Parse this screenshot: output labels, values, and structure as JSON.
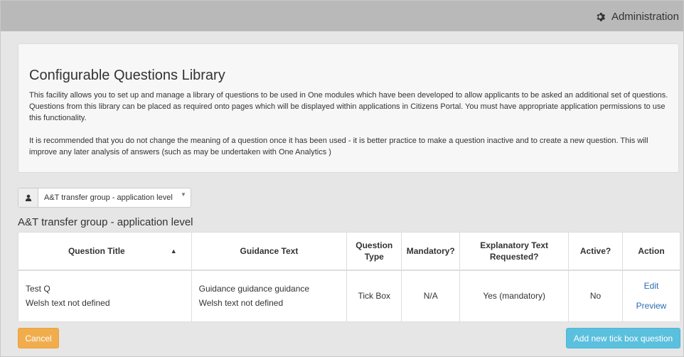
{
  "header": {
    "admin_label": "Administration",
    "admin_icon": "gear-icon"
  },
  "intro": {
    "title": "Configurable Questions Library",
    "paragraph1": "This facility allows you to set up and manage a library of questions to be used in One modules which have been developed to allow applicants to be asked an additional set of questions. Questions from this library can be placed as required onto pages which will be displayed within applications in Citizens Portal. You must have appropriate application permissions to use this functionality.",
    "paragraph2": "It is recommended that you do not change the meaning of a question once it has been used - it is better practice to make a question inactive and to create a new question. This will improve any later analysis of answers (such as may be undertaken with One Analytics )"
  },
  "group_select": {
    "icon": "user-icon",
    "selected": "A&T transfer group - application level"
  },
  "section_title": "A&T transfer group - application level",
  "table": {
    "columns": [
      "Question Title",
      "Guidance Text",
      "Question Type",
      "Mandatory?",
      "Explanatory Text Requested?",
      "Active?",
      "Action"
    ],
    "rows": [
      {
        "title": "Test Q",
        "title_welsh": "Welsh text not defined",
        "guidance": "Guidance guidance guidance",
        "guidance_welsh": "Welsh text not defined",
        "type": "Tick Box",
        "mandatory": "N/A",
        "explanatory": "Yes (mandatory)",
        "active": "No",
        "action_edit": "Edit",
        "action_preview": "Preview"
      }
    ]
  },
  "buttons": {
    "cancel": "Cancel",
    "add": "Add new tick box question"
  },
  "colors": {
    "cancel_bg": "#f0ad4e",
    "add_bg": "#5bc0de",
    "link": "#2a6db0"
  }
}
